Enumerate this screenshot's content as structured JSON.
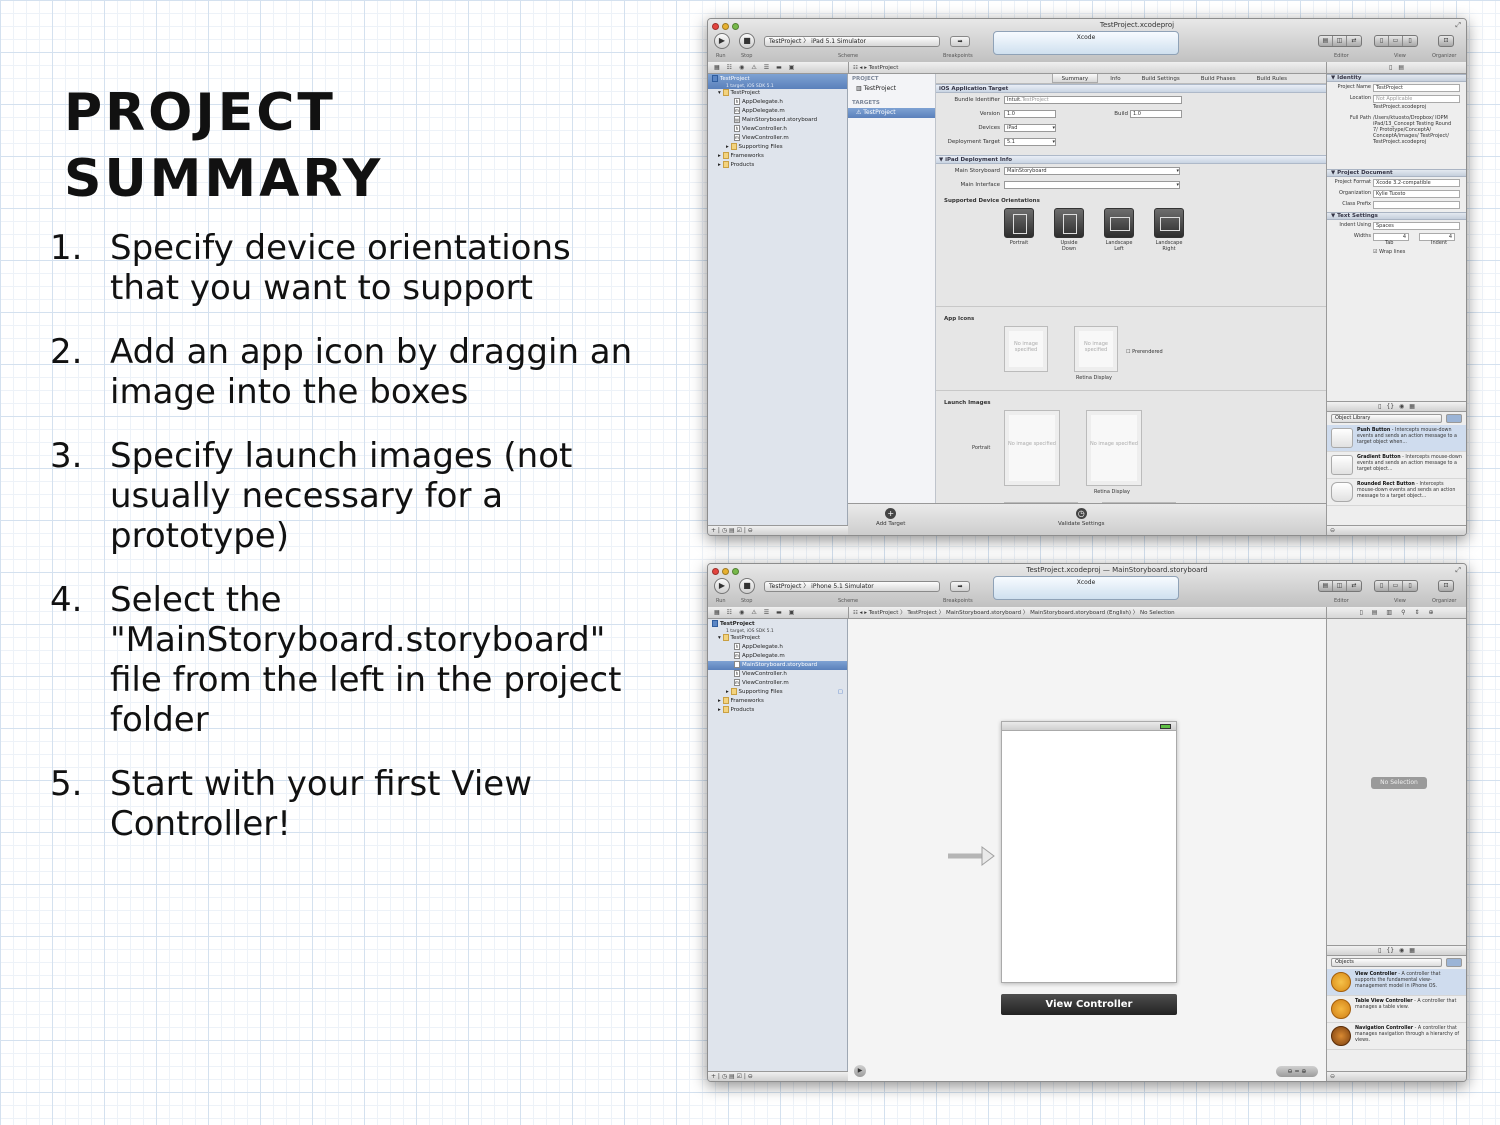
{
  "slide": {
    "title_line1": "Project",
    "title_line2": "Summary",
    "steps": [
      {
        "num": "1.",
        "text": "Specify device orientations that you want to support"
      },
      {
        "num": "2.",
        "text": "Add an app icon by draggin an image into the boxes"
      },
      {
        "num": "3.",
        "text": "Specify launch images (not usually necessary for a prototype)"
      },
      {
        "num": "4.",
        "text": "Select the \"MainStoryboard.storyboard\" file from the left in the project folder"
      },
      {
        "num": "5.",
        "text": "Start with your first View Controller!"
      }
    ]
  },
  "window1": {
    "title": "TestProject.xcodeproj",
    "activity": "Xcode",
    "scheme": "TestProject 〉 iPad 5.1 Simulator",
    "toolbar_labels": {
      "run": "Run",
      "stop": "Stop",
      "scheme": "Scheme",
      "breakpoints": "Breakpoints",
      "editor": "Editor",
      "view": "View",
      "organizer": "Organizer"
    },
    "jump_path": "TestProject",
    "navigator": {
      "project_name": "TestProject",
      "project_sub": "1 target, iOS SDK 5.1",
      "items": [
        {
          "label": "TestProject",
          "icon": "folder-icon",
          "indent": 1
        },
        {
          "label": "AppDelegate.h",
          "icon": "h",
          "indent": 2
        },
        {
          "label": "AppDelegate.m",
          "icon": "m",
          "indent": 2
        },
        {
          "label": "MainStoryboard.storyboard",
          "icon": "sb",
          "indent": 2
        },
        {
          "label": "ViewController.h",
          "icon": "h",
          "indent": 2
        },
        {
          "label": "ViewController.m",
          "icon": "m",
          "indent": 2
        },
        {
          "label": "Supporting Files",
          "icon": "folder-icon",
          "indent": 2
        },
        {
          "label": "Frameworks",
          "icon": "folder-icon",
          "indent": 1
        },
        {
          "label": "Products",
          "icon": "folder-icon",
          "indent": 1
        }
      ]
    },
    "project_list": {
      "project_header": "PROJECT",
      "project_item": "TestProject",
      "targets_header": "TARGETS",
      "target_item": "TestProject"
    },
    "tabs": [
      "Summary",
      "Info",
      "Build Settings",
      "Build Phases",
      "Build Rules"
    ],
    "ios_target": {
      "section": "iOS Application Target",
      "bundle_label": "Bundle Identifier",
      "bundle_prefix": "Intuit.",
      "bundle_value": "TestProject",
      "version_label": "Version",
      "version_value": "1.0",
      "build_label": "Build",
      "build_value": "1.0",
      "devices_label": "Devices",
      "devices_value": "iPad",
      "deploy_label": "Deployment Target",
      "deploy_value": "5.1"
    },
    "ipad_deploy": {
      "section": "iPad Deployment Info",
      "storyboard_label": "Main Storyboard",
      "storyboard_value": "MainStoryboard",
      "interface_label": "Main Interface",
      "orient_header": "Supported Device Orientations",
      "orientations": [
        {
          "line1": "Portrait",
          "line2": ""
        },
        {
          "line1": "Upside",
          "line2": "Down"
        },
        {
          "line1": "Landscape",
          "line2": "Left"
        },
        {
          "line1": "Landscape",
          "line2": "Right"
        }
      ],
      "app_icons_header": "App Icons",
      "no_image": "No image specified",
      "retina": "Retina Display",
      "prerendered": "Prerendered",
      "launch_header": "Launch Images",
      "portrait": "Portrait"
    },
    "bottom": {
      "add_target": "Add Target",
      "validate": "Validate Settings"
    },
    "inspector": {
      "identity_header": "Identity",
      "project_name_label": "Project Name",
      "project_name_value": "TestProject",
      "location_label": "Location",
      "location_value": "Not Applicable",
      "file_name": "TestProject.xcodeproj",
      "full_path_label": "Full Path",
      "full_path_value": "/Users/ktuosto/Dropbox/ IOPM iPad/13_Concept Testing Round 7/ Prototype/ConceptA/ ConceptA/images/ TestProject/ TestProject.xcodeproj",
      "doc_header": "Project Document",
      "format_label": "Project Format",
      "format_value": "Xcode 3.2-compatible",
      "org_label": "Organization",
      "org_value": "Kylie Tuosto",
      "class_prefix_label": "Class Prefix",
      "text_header": "Text Settings",
      "indent_using_label": "Indent Using",
      "indent_using_value": "Spaces",
      "widths_label": "Widths",
      "tab_width": "4",
      "indent_width": "4",
      "tab_label": "Tab",
      "indent_label": "Indent",
      "wrap_label": "Wrap lines"
    },
    "library": {
      "filter": "Object Library",
      "items": [
        {
          "title": "Push Button",
          "desc": " - Intercepts mouse-down events and sends an action message to a target object when..."
        },
        {
          "title": "Gradient Button",
          "desc": " - Intercepts mouse-down events and sends an action message to a target object..."
        },
        {
          "title": "Rounded Rect Button",
          "desc": " - Intercepts mouse-down events and sends an action message to a target object..."
        }
      ]
    }
  },
  "window2": {
    "title": "TestProject.xcodeproj — MainStoryboard.storyboard",
    "activity": "Xcode",
    "scheme": "TestProject 〉 iPhone 5.1 Simulator",
    "jump_path": "TestProject 〉 TestProject 〉 MainStoryboard.storyboard 〉 MainStoryboard.storyboard (English) 〉 No Selection",
    "navigator": {
      "project_name": "TestProject",
      "project_sub": "1 target, iOS SDK 5.1",
      "items": [
        {
          "label": "TestProject",
          "icon": "folder-icon",
          "indent": 1
        },
        {
          "label": "AppDelegate.h",
          "icon": "h",
          "indent": 2
        },
        {
          "label": "AppDelegate.m",
          "icon": "m",
          "indent": 2
        },
        {
          "label": "MainStoryboard.storyboard",
          "icon": "sb",
          "indent": 2,
          "selected": true
        },
        {
          "label": "ViewController.h",
          "icon": "h",
          "indent": 2
        },
        {
          "label": "ViewController.m",
          "icon": "m",
          "indent": 2
        },
        {
          "label": "Supporting Files",
          "icon": "folder-icon",
          "indent": 2
        },
        {
          "label": "Frameworks",
          "icon": "folder-icon",
          "indent": 1
        },
        {
          "label": "Products",
          "icon": "folder-icon",
          "indent": 1
        }
      ]
    },
    "scene_label": "View Controller",
    "no_selection": "No Selection",
    "library": {
      "filter": "Objects",
      "items": [
        {
          "title": "View Controller",
          "desc": " - A controller that supports the fundamental view-management model in iPhone OS.",
          "icon": "vc"
        },
        {
          "title": "Table View Controller",
          "desc": " - A controller that manages a table view.",
          "icon": "tvc"
        },
        {
          "title": "Navigation Controller",
          "desc": " - A controller that manages navigation through a hierarchy of views.",
          "icon": "nav"
        }
      ]
    }
  }
}
